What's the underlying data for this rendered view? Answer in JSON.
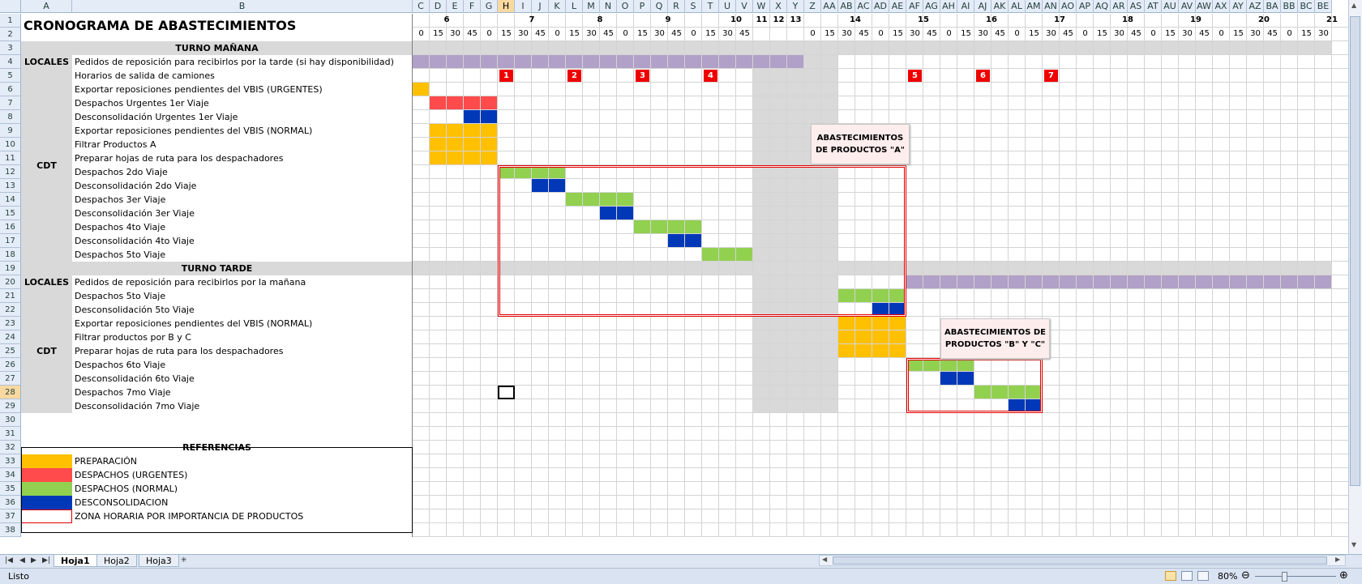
{
  "sheet": {
    "title": "CRONOGRAMA DE ABASTECIMIENTOS",
    "columns": [
      "A",
      "B",
      "C",
      "D",
      "E",
      "F",
      "G",
      "H",
      "I",
      "J",
      "K",
      "L",
      "M",
      "N",
      "O",
      "P",
      "Q",
      "R",
      "S",
      "T",
      "U",
      "V",
      "W",
      "X",
      "Y",
      "Z",
      "AA",
      "AB",
      "AC",
      "AD",
      "AE",
      "AF",
      "AG",
      "AH",
      "AI",
      "AJ",
      "AK",
      "AL",
      "AM",
      "AN",
      "AO",
      "AP",
      "AQ",
      "AR",
      "AS",
      "AT",
      "AU",
      "AV",
      "AW",
      "AX",
      "AY",
      "AZ",
      "BA",
      "BB",
      "BC",
      "BE"
    ],
    "selected_column": "H",
    "selected_row": "28",
    "row_numbers": [
      "1",
      "2",
      "3",
      "4",
      "5",
      "6",
      "7",
      "8",
      "9",
      "10",
      "11",
      "12",
      "13",
      "14",
      "15",
      "16",
      "17",
      "18",
      "19",
      "20",
      "21",
      "22",
      "23",
      "24",
      "25",
      "26",
      "27",
      "28",
      "29",
      "30",
      "31",
      "32",
      "33",
      "34",
      "35",
      "36",
      "37",
      "38"
    ],
    "hour_labels": [
      {
        "col": "C",
        "text": "6"
      },
      {
        "col": "H",
        "text": "7"
      },
      {
        "col": "L",
        "text": "8"
      },
      {
        "col": "P",
        "text": "9"
      },
      {
        "col": "T",
        "text": "10"
      },
      {
        "col": "W",
        "text": "11"
      },
      {
        "col": "X",
        "text": "12"
      },
      {
        "col": "Y",
        "text": "13"
      },
      {
        "col": "AA",
        "text": "14"
      },
      {
        "col": "AE",
        "text": "15"
      },
      {
        "col": "AI",
        "text": "16"
      },
      {
        "col": "AM",
        "text": "17"
      },
      {
        "col": "AQ",
        "text": "18"
      },
      {
        "col": "AU",
        "text": "19"
      },
      {
        "col": "AY",
        "text": "20"
      },
      {
        "col": "BC",
        "text": "21"
      }
    ],
    "minute_cols": [
      "C",
      "D",
      "E",
      "F",
      "G",
      "H",
      "I",
      "J",
      "K",
      "L",
      "M",
      "N",
      "O",
      "P",
      "Q",
      "R",
      "S",
      "T",
      "U",
      "V",
      "Z",
      "AA",
      "AB",
      "AC",
      "AD",
      "AE",
      "AF",
      "AG",
      "AH",
      "AI",
      "AJ",
      "AK",
      "AL",
      "AM",
      "AN",
      "AO",
      "AP",
      "AQ",
      "AR",
      "AS",
      "AT",
      "AU",
      "AV",
      "AW",
      "AX",
      "AY",
      "AZ",
      "BA",
      "BB",
      "BC",
      "BE"
    ],
    "minute_values": [
      "0",
      "15",
      "30",
      "45",
      "0",
      "15",
      "30",
      "45",
      "0",
      "15",
      "30",
      "45",
      "0",
      "15",
      "30",
      "45",
      "0",
      "15",
      "30",
      "45",
      "0",
      "15",
      "30",
      "45",
      "0",
      "15",
      "30",
      "45",
      "0",
      "15",
      "30",
      "45",
      "0",
      "15",
      "30",
      "45",
      "0",
      "15",
      "30",
      "45",
      "0",
      "15",
      "30",
      "45",
      "0",
      "15",
      "30",
      "45",
      "0",
      "15",
      "30"
    ],
    "turno_manana": "TURNO MAÑANA",
    "turno_tarde": "TURNO TARDE",
    "locales": "LOCALES",
    "cdt": "CDT",
    "tasks": [
      {
        "row": 4,
        "text": "Pedidos de reposición para recibirlos por la tarde (si hay disponibilidad)"
      },
      {
        "row": 5,
        "text": "Horarios de salida de camiones"
      },
      {
        "row": 6,
        "text": "Exportar reposiciones pendientes del VBIS (URGENTES)"
      },
      {
        "row": 7,
        "text": "Despachos Urgentes 1er Viaje"
      },
      {
        "row": 8,
        "text": "Desconsolidación Urgentes 1er Viaje"
      },
      {
        "row": 9,
        "text": "Exportar reposiciones pendientes del VBIS (NORMAL)"
      },
      {
        "row": 10,
        "text": "Filtrar Productos A"
      },
      {
        "row": 11,
        "text": "Preparar hojas de ruta para los despachadores"
      },
      {
        "row": 12,
        "text": "Despachos 2do Viaje"
      },
      {
        "row": 13,
        "text": "Desconsolidación 2do Viaje"
      },
      {
        "row": 14,
        "text": "Despachos 3er Viaje"
      },
      {
        "row": 15,
        "text": "Desconsolidación 3er Viaje"
      },
      {
        "row": 16,
        "text": "Despachos 4to Viaje"
      },
      {
        "row": 17,
        "text": "Desconsolidación 4to Viaje"
      },
      {
        "row": 18,
        "text": "Despachos 5to Viaje"
      },
      {
        "row": 20,
        "text": "Pedidos de reposición para recibirlos por la mañana"
      },
      {
        "row": 21,
        "text": "Despachos 5to Viaje"
      },
      {
        "row": 22,
        "text": "Desconsolidación 5to Viaje"
      },
      {
        "row": 23,
        "text": "Exportar reposiciones pendientes del VBIS (NORMAL)"
      },
      {
        "row": 24,
        "text": "Filtrar productos por B y C"
      },
      {
        "row": 25,
        "text": "Preparar hojas de ruta para los despachadores"
      },
      {
        "row": 26,
        "text": "Despachos 6to Viaje"
      },
      {
        "row": 27,
        "text": "Desconsolidación 6to Viaje"
      },
      {
        "row": 28,
        "text": "Despachos 7mo Viaje"
      },
      {
        "row": 29,
        "text": "Desconsolidación 7mo Viaje"
      }
    ],
    "trucks": [
      {
        "col": "H",
        "text": "1"
      },
      {
        "col": "L",
        "text": "2"
      },
      {
        "col": "P",
        "text": "3"
      },
      {
        "col": "T",
        "text": "4"
      },
      {
        "col": "AF",
        "text": "5"
      },
      {
        "col": "AJ",
        "text": "6"
      },
      {
        "col": "AN",
        "text": "7"
      }
    ],
    "callout_a": "ABASTECIMIENTOS DE PRODUCTOS \"A\"",
    "callout_bc": "ABASTECIMIENTOS DE PRODUCTOS \"B\" Y \"C\"",
    "references_title": "REFERENCIAS",
    "references": [
      {
        "color": "#ffc000",
        "label": "PREPARACIÓN"
      },
      {
        "color": "#ff4b4b",
        "label": "DESPACHOS (URGENTES)"
      },
      {
        "color": "#92d050",
        "label": "DESPACHOS (NORMAL)"
      },
      {
        "color": "#0038b8",
        "label": "DESCONSOLIDACION"
      },
      {
        "color": "outline-red",
        "label": "ZONA HORARIA POR IMPORTANCIA DE PRODUCTOS"
      }
    ],
    "colors": {
      "preparacion": "#ffc000",
      "urgentes": "#ff4b4b",
      "normal": "#92d050",
      "desconsolidacion": "#0038b8",
      "pedidos": "#b1a0c7",
      "break": "#d9d9d9",
      "header_gray": "#d9d9d9"
    }
  },
  "tabs": [
    "Hoja1",
    "Hoja2",
    "Hoja3"
  ],
  "active_tab": "Hoja1",
  "status": {
    "ready": "Listo",
    "zoom": "80%"
  }
}
